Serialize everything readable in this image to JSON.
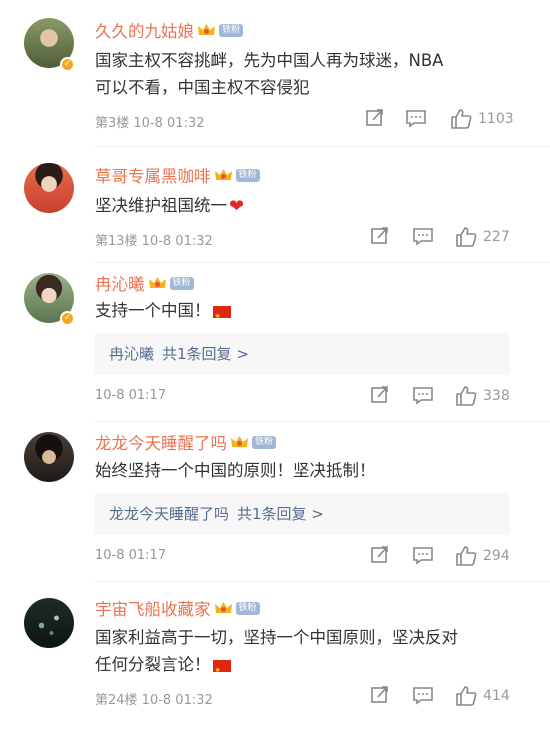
{
  "comments": [
    {
      "username": "久久的九姑娘",
      "fan_badge": "铁粉",
      "text_lines": [
        "国家主权不容挑衅，先为中国人再为球迷，NBA",
        "可以不看，中国主权不容侵犯"
      ],
      "meta": "第3楼  10-8 01:32",
      "likes": "1103",
      "avatar_color": "#5b6b45",
      "verified": true
    },
    {
      "username": "草哥专属黑咖啡",
      "fan_badge": "铁粉",
      "text_lines": [
        "坚决维护祖国统一"
      ],
      "meta": "第13楼  10-8 01:32",
      "likes": "227",
      "avatar_color": "#d8533a",
      "verified": false
    },
    {
      "username": "冉沁曦",
      "fan_badge": "铁粉",
      "text_lines": [
        "支持一个中国！"
      ],
      "reply_name": "冉沁曦",
      "reply_count": "共1条回复 >",
      "meta": "10-8 01:17",
      "likes": "338",
      "avatar_color": "#6f8a5e",
      "verified": true
    },
    {
      "username": "龙龙今天睡醒了吗",
      "fan_badge": "铁粉",
      "text_lines": [
        "始终坚持一个中国的原则！坚决抵制！"
      ],
      "reply_name": "龙龙今天睡醒了吗",
      "reply_count": "共1条回复 >",
      "meta": "10-8 01:17",
      "likes": "294",
      "avatar_color": "#2d2622",
      "verified": false
    },
    {
      "username": "宇宙飞船收藏家",
      "fan_badge": "铁粉",
      "text_lines": [
        "国家利益高于一切，坚持一个中国原则，坚决反对",
        "任何分裂言论！"
      ],
      "meta": "第24楼  10-8 01:32",
      "likes": "414",
      "avatar_color": "#17231f",
      "verified": false
    }
  ],
  "colors": {
    "username": "#eb7350",
    "reply_link": "#5b6d8e",
    "meta": "#999999",
    "flag": "#de2910"
  },
  "icons": [
    "share-icon",
    "comment-icon",
    "like-icon",
    "crown-icon",
    "verified-icon",
    "china-flag-emoji",
    "red-heart-emoji"
  ]
}
